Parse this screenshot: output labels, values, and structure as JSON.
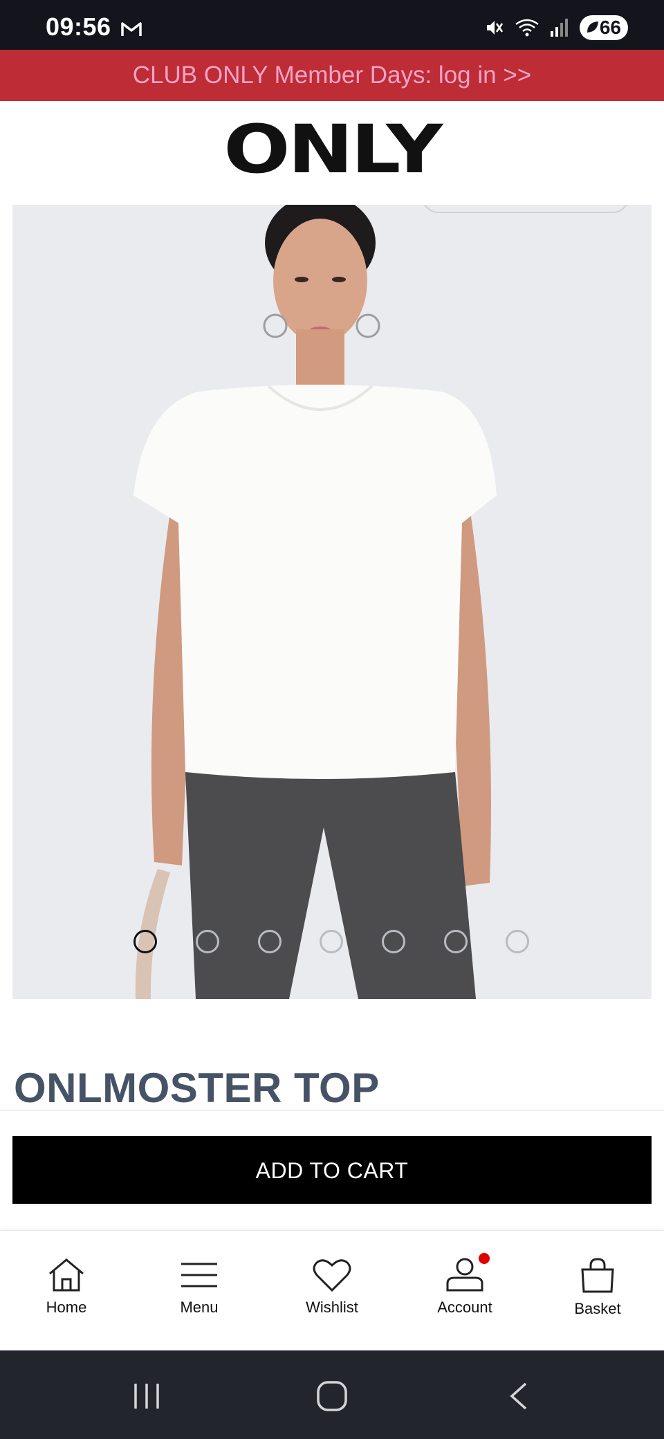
{
  "status_bar": {
    "time": "09:56",
    "battery": "66",
    "icons": [
      "gmail-icon",
      "mute-icon",
      "wifi-icon",
      "signal-icon",
      "battery-icon"
    ]
  },
  "promo": {
    "text": "CLUB ONLY Member Days: log in >>",
    "background": "#be2c35",
    "text_color": "#f4a3c6"
  },
  "brand": {
    "logo_text": "ONLY"
  },
  "product": {
    "title": "ONLMOSTER TOP",
    "image_carousel": {
      "count": 7,
      "active_index": 0
    }
  },
  "actions": {
    "add_to_cart": "ADD TO CART"
  },
  "bottom_nav": {
    "items": [
      {
        "label": "Home",
        "icon": "home-icon"
      },
      {
        "label": "Menu",
        "icon": "menu-icon"
      },
      {
        "label": "Wishlist",
        "icon": "heart-icon"
      },
      {
        "label": "Account",
        "icon": "account-icon",
        "notification": true
      },
      {
        "label": "Basket",
        "icon": "bag-icon"
      }
    ]
  },
  "android_nav": {
    "icons": [
      "recent-apps-icon",
      "home-circle-icon",
      "back-icon"
    ]
  }
}
